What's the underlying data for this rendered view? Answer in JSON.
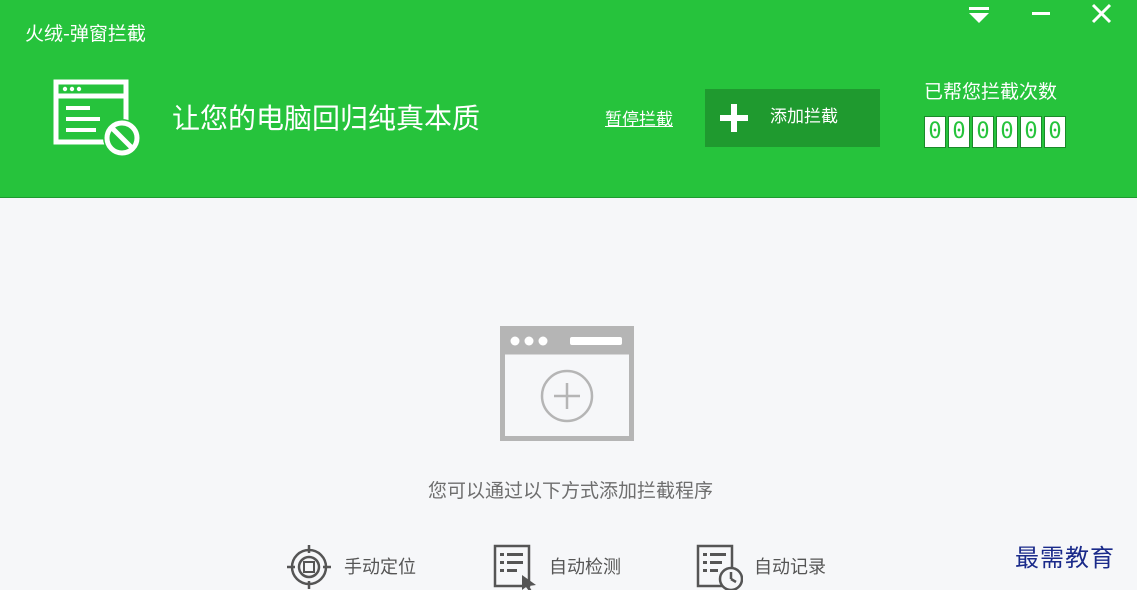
{
  "window": {
    "title": "火绒-弹窗拦截",
    "controls": [
      "menu-icon",
      "minimize-icon",
      "close-icon"
    ]
  },
  "header": {
    "slogan": "让您的电脑回归纯真本质",
    "pause_label": "暂停拦截",
    "add_label": "添加拦截",
    "counter_label": "已帮您拦截次数",
    "counter_digits": [
      "0",
      "0",
      "0",
      "0",
      "0",
      "0"
    ]
  },
  "main": {
    "hint": "您可以通过以下方式添加拦截程序",
    "options": [
      {
        "label": "手动定位",
        "icon": "crosshair-icon"
      },
      {
        "label": "自动检测",
        "icon": "list-cursor-icon"
      },
      {
        "label": "自动记录",
        "icon": "list-clock-icon"
      }
    ]
  },
  "watermark": "最需教育",
  "colors": {
    "brand_green": "#26c33c",
    "button_green": "#1f9a2f",
    "body_background": "#f6f7f9",
    "icon_gray": "#b5b5b5"
  }
}
